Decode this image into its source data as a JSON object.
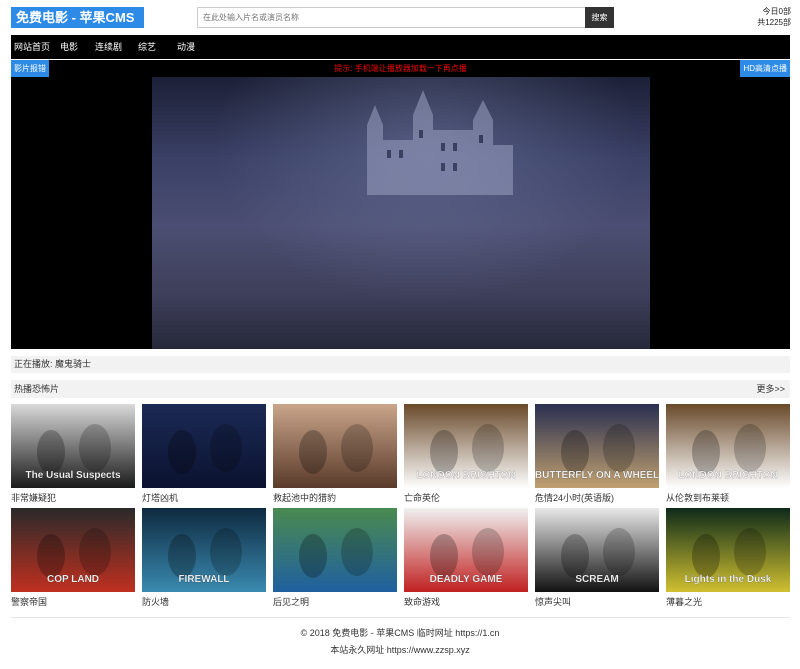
{
  "header": {
    "logo": "免费电影 - 苹果CMS",
    "search_placeholder": "在此处输入片名或演员名称",
    "search_button": "搜索",
    "today_count": "今日0部",
    "total_count": "共1225部"
  },
  "nav": {
    "items": [
      {
        "label": "网站首页"
      },
      {
        "label": "电影"
      },
      {
        "label": "连续剧"
      },
      {
        "label": "综艺"
      },
      {
        "label": "动漫"
      }
    ]
  },
  "player": {
    "report_button": "影片报错",
    "tip": "提示: 手机端让播放器加载一下再点播",
    "hd_button": "HD高清点播"
  },
  "now_playing": "正在播放: 魔鬼骑士",
  "section": {
    "title": "热播恐怖片",
    "more": "更多>>",
    "movies": [
      {
        "title": "非常嫌疑犯",
        "poster_text": "The Usual Suspects",
        "colors": [
          "#d9d9d9",
          "#1a1a1a"
        ]
      },
      {
        "title": "灯塔凶机",
        "poster_text": "",
        "colors": [
          "#1b2a55",
          "#0b1230"
        ]
      },
      {
        "title": "救起池中的猎豹",
        "poster_text": "",
        "colors": [
          "#c9a58a",
          "#5a3a2a"
        ]
      },
      {
        "title": "亡命英伦",
        "poster_text": "LONDON BRIGHTON",
        "colors": [
          "#6a4a2a",
          "#ffffff"
        ]
      },
      {
        "title": "危情24小时(英语版)",
        "poster_text": "BUTTERFLY ON A WHEEL",
        "colors": [
          "#2a3050",
          "#c0a070"
        ]
      },
      {
        "title": "从伦敦到布莱顿",
        "poster_text": "LONDON BRIGHTON",
        "colors": [
          "#6a4a2a",
          "#ffffff"
        ]
      },
      {
        "title": "警察帝国",
        "poster_text": "COP LAND",
        "colors": [
          "#2a2a2a",
          "#c03020"
        ]
      },
      {
        "title": "防火墙",
        "poster_text": "FIREWALL",
        "colors": [
          "#0e2a40",
          "#3a8ab0"
        ]
      },
      {
        "title": "后见之明",
        "poster_text": "",
        "colors": [
          "#4a8a50",
          "#2060a0"
        ]
      },
      {
        "title": "致命游戏",
        "poster_text": "DEADLY GAME",
        "colors": [
          "#f0f0f0",
          "#c02020"
        ]
      },
      {
        "title": "惊声尖叫",
        "poster_text": "SCREAM",
        "colors": [
          "#e8e8e8",
          "#111111"
        ]
      },
      {
        "title": "薄暮之光",
        "poster_text": "Lights in the Dusk",
        "colors": [
          "#0e2a1a",
          "#d0c030"
        ]
      }
    ]
  },
  "footer": {
    "line1": "© 2018 免费电影 - 苹果CMS 临时网址 https://1.cn",
    "line2": "本站永久网址 https://www.zzsp.xyz"
  }
}
